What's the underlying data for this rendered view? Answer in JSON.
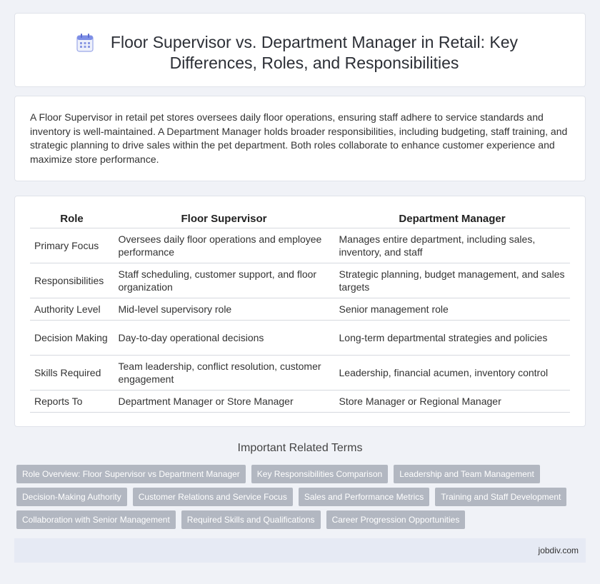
{
  "header": {
    "icon": "calendar-icon",
    "title": "Floor Supervisor vs. Department Manager in Retail: Key Differences, Roles, and Responsibilities"
  },
  "intro": {
    "text": "A Floor Supervisor in retail pet stores oversees daily floor operations, ensuring staff adhere to service standards and inventory is well-maintained. A Department Manager holds broader responsibilities, including budgeting, staff training, and strategic planning to drive sales within the pet department. Both roles collaborate to enhance customer experience and maximize store performance."
  },
  "table": {
    "headers": [
      "Role",
      "Floor Supervisor",
      "Department Manager"
    ],
    "rows": [
      [
        "Primary Focus",
        "Oversees daily floor operations and employee performance",
        "Manages entire department, including sales, inventory, and staff"
      ],
      [
        "Responsibilities",
        "Staff scheduling, customer support, and floor organization",
        "Strategic planning, budget management, and sales targets"
      ],
      [
        "Authority Level",
        "Mid-level supervisory role",
        "Senior management role"
      ],
      [
        "Decision Making",
        "Day-to-day operational decisions",
        "Long-term departmental strategies and policies"
      ],
      [
        "Skills Required",
        "Team leadership, conflict resolution, customer engagement",
        "Leadership, financial acumen, inventory control"
      ],
      [
        "Reports To",
        "Department Manager or Store Manager",
        "Store Manager or Regional Manager"
      ]
    ]
  },
  "related": {
    "title": "Important Related Terms",
    "tags": [
      "Role Overview: Floor Supervisor vs Department Manager",
      "Key Responsibilities Comparison",
      "Leadership and Team Management",
      "Decision-Making Authority",
      "Customer Relations and Service Focus",
      "Sales and Performance Metrics",
      "Training and Staff Development",
      "Collaboration with Senior Management",
      "Required Skills and Qualifications",
      "Career Progression Opportunities"
    ]
  },
  "footer": {
    "site": "jobdiv.com"
  },
  "colors": {
    "background": "#f0f2f7",
    "tag_bg": "#b2b7c1",
    "footer_bg": "#e6eaf4",
    "icon_accent": "#6b7fe0"
  }
}
